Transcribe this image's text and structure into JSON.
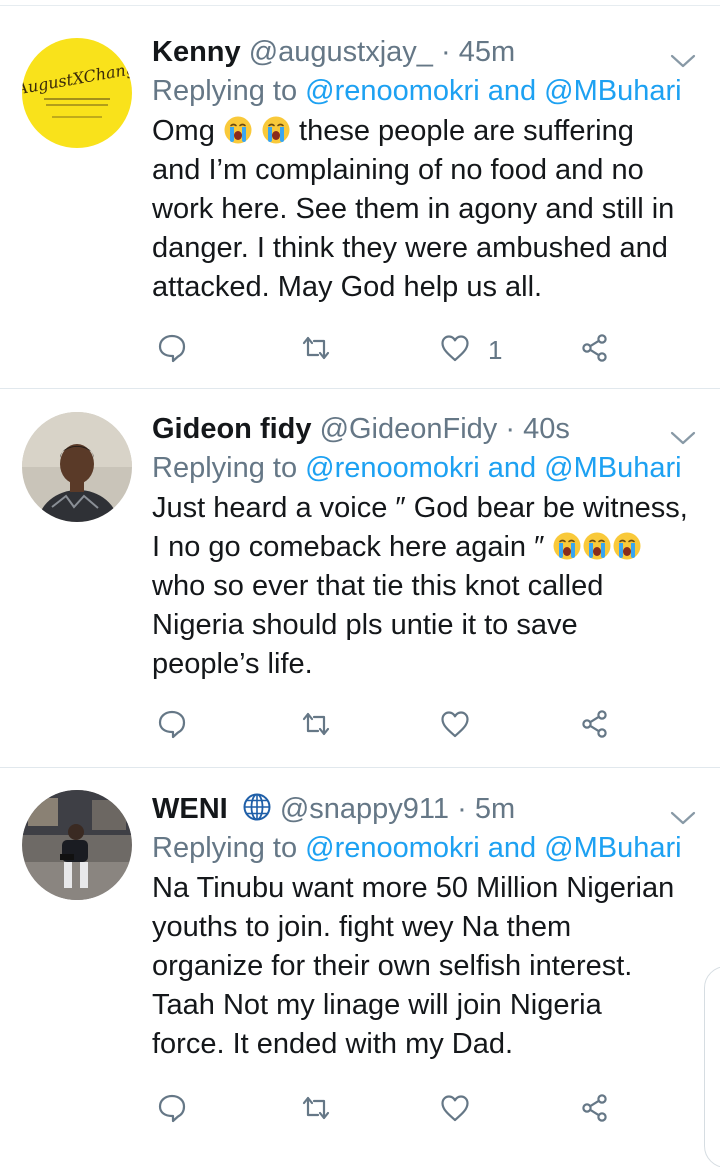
{
  "tweets": [
    {
      "name": "Kenny",
      "handle": "@augustxjay_",
      "separator": "·",
      "time": "45m",
      "verified_globe": false,
      "reply_prefix": "Replying to",
      "reply_mentions": "@renoomokri and @MBuhari",
      "avatar_text": "AugustXChang",
      "avatar_color": "#f9e21b",
      "body_lines": [
        [
          "Omg ",
          "emoji:crying-face",
          " ",
          "emoji:crying-face",
          " these people are suffering"
        ],
        [
          "and I’m complaining of no food and no"
        ],
        [
          "work here. See them in agony and still in"
        ],
        [
          "danger. I think they were ambushed and"
        ],
        [
          "attacked. May God help us all."
        ]
      ],
      "like_count": "1",
      "icons": [
        "reply-icon",
        "retweet-icon",
        "like-icon",
        "share-icon"
      ]
    },
    {
      "name": "Gideon fidy",
      "handle": "@GideonFidy",
      "separator": "·",
      "time": "40s",
      "verified_globe": false,
      "reply_prefix": "Replying to",
      "reply_mentions": "@renoomokri and @MBuhari",
      "body_lines": [
        [
          "Just heard a voice ″ God bear be witness,"
        ],
        [
          "I no go comeback here again ″ ",
          "emoji:crying-face",
          "emoji:crying-face",
          "emoji:crying-face"
        ],
        [
          "who so ever that tie this knot called"
        ],
        [
          "Nigeria should pls untie it to save"
        ],
        [
          "people’s life."
        ]
      ],
      "like_count": "",
      "icons": [
        "reply-icon",
        "retweet-icon",
        "like-icon",
        "share-icon"
      ]
    },
    {
      "name": "WENI",
      "handle": "@snappy911",
      "separator": "·",
      "time": "5m",
      "verified_globe": true,
      "reply_prefix": "Replying to",
      "reply_mentions": "@renoomokri and @MBuhari",
      "body_lines": [
        [
          "Na Tinubu want more 50 Million Nigerian"
        ],
        [
          "youths to join.  fight wey Na them"
        ],
        [
          "organize for their own selfish interest."
        ],
        [
          "Taah Not my linage will join Nigeria"
        ],
        [
          "force. It ended with my Dad."
        ]
      ],
      "like_count": "",
      "icons": [
        "reply-icon",
        "retweet-icon",
        "like-icon",
        "share-icon"
      ]
    }
  ],
  "colors": {
    "text": "#14171a",
    "muted": "#657786",
    "mention": "#1da1f2",
    "divider": "#e1e8ed"
  }
}
